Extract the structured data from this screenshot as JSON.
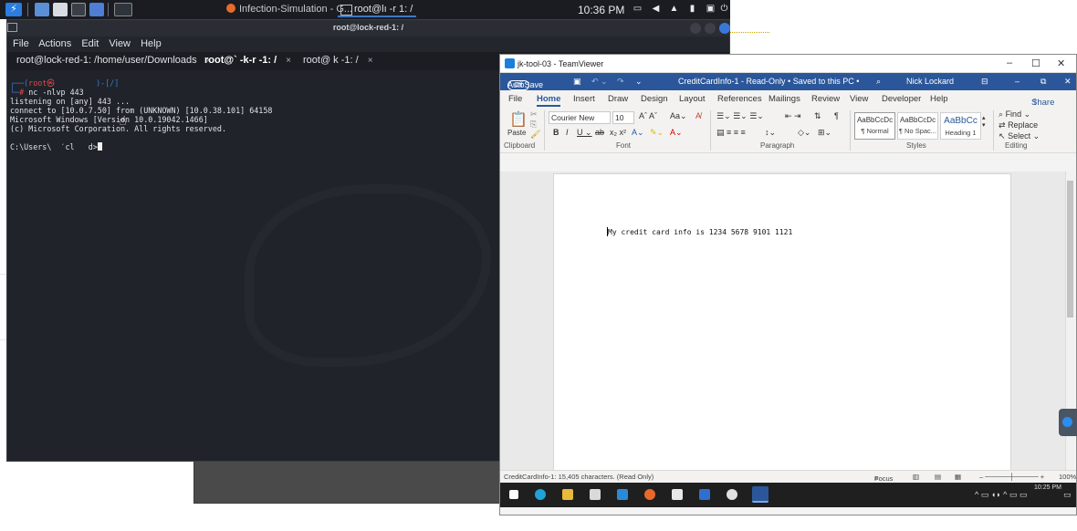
{
  "kali_panel": {
    "browser_task": "Infection-Simulation - G...",
    "terminal_task": "root@lı   -r   1: /",
    "clock": "10:36 PM"
  },
  "terminal": {
    "title": "root@lock-red-1: /",
    "menu": [
      "File",
      "Actions",
      "Edit",
      "View",
      "Help"
    ],
    "tabs": [
      {
        "label": "root@lock-red-1: /home/user/Downloads"
      },
      {
        "label": "root@`  -k-r   -1: /"
      },
      {
        "label": "root@  k      -1: /"
      }
    ],
    "tab_close": "×",
    "prompt_user": "root㉿",
    "prompt_path": ")-[/]",
    "command": "nc -nlvp 443",
    "output": [
      "listening on [any] 443 ...",
      "connect to [10.0.7.50] from (UNKNOWN) [10.0.38.101] 64158",
      "Microsoft Windows [Version 10.0.19042.1466]",
      "(c) Microsoft Corporation. All rights reserved."
    ],
    "cmd_prompt": "C:\\Users\\  ˊcl   d>"
  },
  "teamviewer": {
    "title": "jk-tool-03 - TeamViewer"
  },
  "word": {
    "autosave": "AutoSave",
    "autosave_state": "Off",
    "doc_title": "CreditCardInfo-1 - Read-Only • Saved to this PC •",
    "user": "Nick Lockard",
    "tabs": [
      "File",
      "Home",
      "Insert",
      "Draw",
      "Design",
      "Layout",
      "References",
      "Mailings",
      "Review",
      "View",
      "Developer",
      "Help"
    ],
    "share": "Share",
    "font_name": "Courier New",
    "font_size": "10",
    "paste_label": "Paste",
    "groups": [
      "Clipboard",
      "Font",
      "Paragraph",
      "Styles",
      "Editing"
    ],
    "styles": [
      {
        "preview": "AaBbCcDc",
        "name": "¶ Normal"
      },
      {
        "preview": "AaBbCcDc",
        "name": "¶ No Spac..."
      },
      {
        "preview": "AaBbCc",
        "name": "Heading 1"
      }
    ],
    "editing": [
      "Find",
      "Replace",
      "Select"
    ],
    "document_text": "My credit card info is 1234 5678 9101 1121",
    "status_left": "CreditCardInfo-1: 15,405 characters.  (Read Only)",
    "focus": "Focus",
    "zoom": "100%",
    "win_time": "10:25 PM"
  },
  "colors": {
    "word_blue": "#2b579a",
    "kali_blue": "#2a7de1",
    "prompt_red": "#e5484d"
  }
}
